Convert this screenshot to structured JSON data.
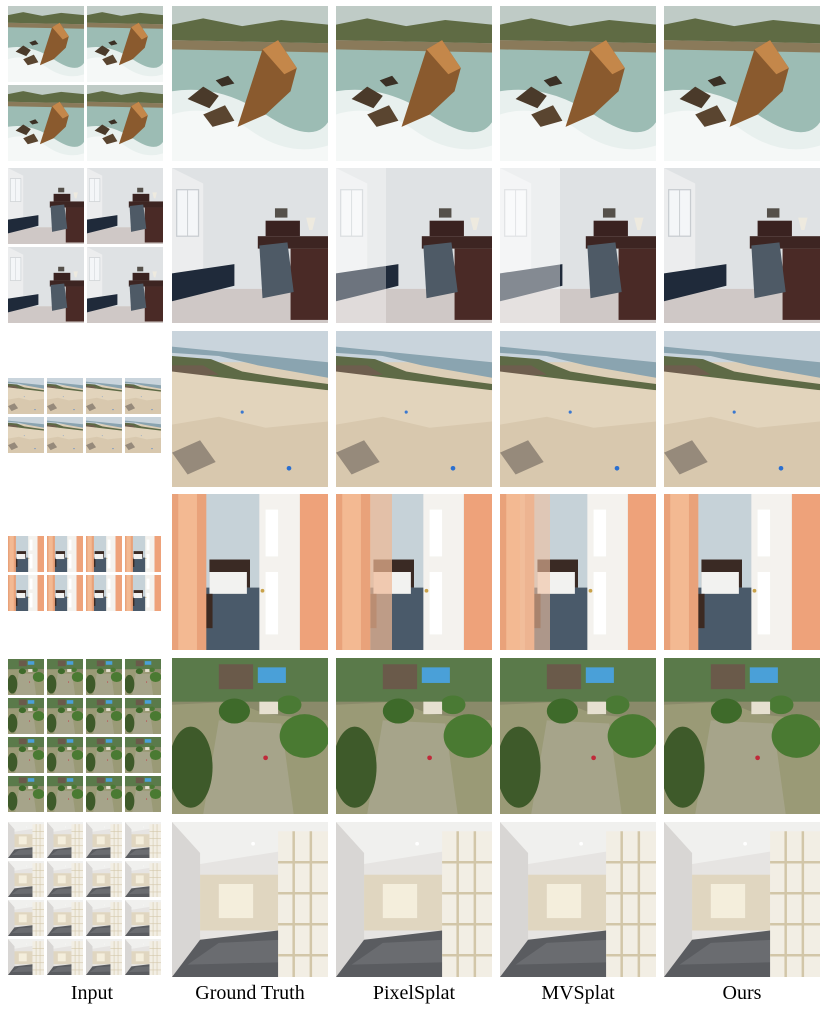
{
  "column_labels": {
    "input": "Input",
    "ground_truth": "Ground Truth",
    "pixelsplat": "PixelSplat",
    "mvsplat": "MVSplat",
    "ours": "Ours"
  },
  "rows": [
    {
      "scene": "coastal-rock",
      "input_grid": "2x2",
      "input_views": 4
    },
    {
      "scene": "bedroom-window",
      "input_grid": "2x2",
      "input_views": 4
    },
    {
      "scene": "beach-aerial",
      "input_grid": "2x4",
      "input_views": 8
    },
    {
      "scene": "bedroom-door",
      "input_grid": "2x4",
      "input_views": 8
    },
    {
      "scene": "garden-aerial",
      "input_grid": "4x4",
      "input_views": 16
    },
    {
      "scene": "basement-room",
      "input_grid": "4x4",
      "input_views": 16
    }
  ]
}
